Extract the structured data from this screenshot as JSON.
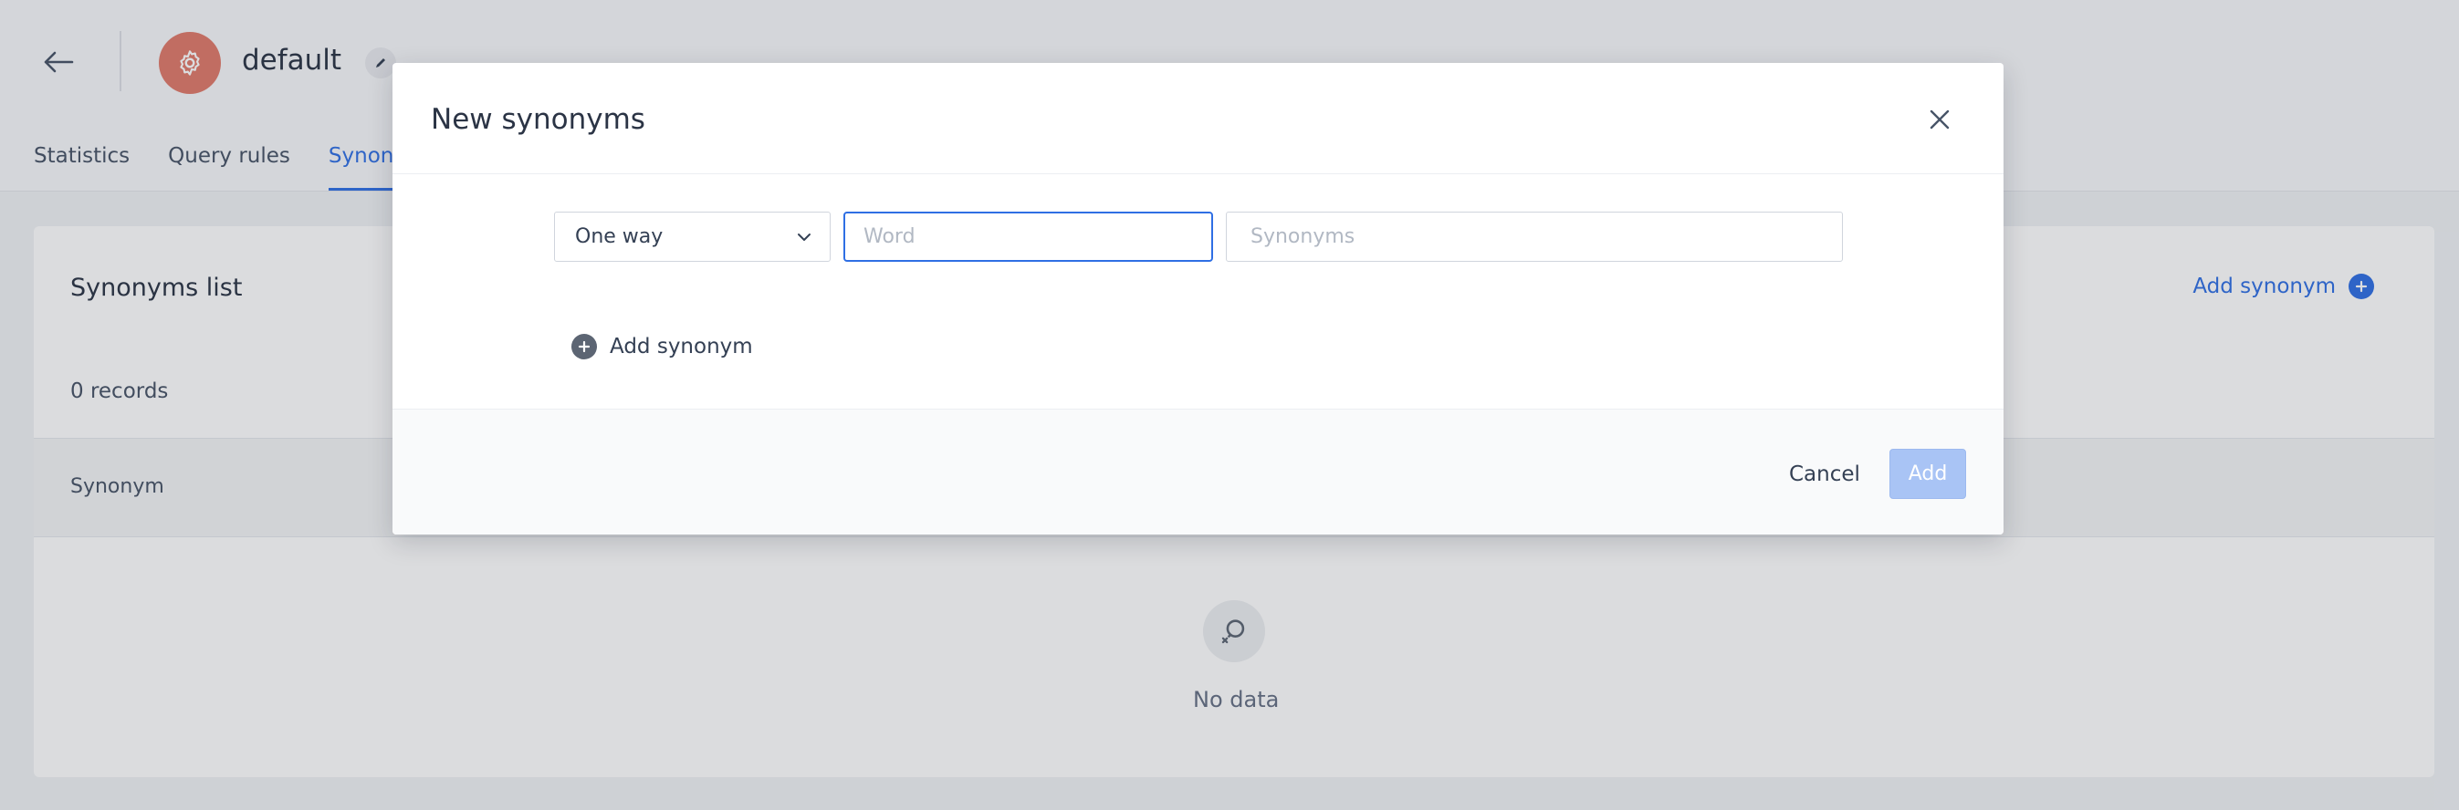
{
  "page": {
    "index_name": "default",
    "tabs": [
      "Statistics",
      "Query rules",
      "Synonyms"
    ],
    "active_tab": "Synonyms"
  },
  "card": {
    "title": "Synonyms list",
    "add_label": "Add synonym",
    "records": "0 records",
    "column_header": "Synonym",
    "empty_text": "No data"
  },
  "modal": {
    "title": "New synonyms",
    "type_select": {
      "value": "One way"
    },
    "word_input": {
      "value": "",
      "placeholder": "Word"
    },
    "synonyms_input": {
      "value": "",
      "placeholder": "Synonyms"
    },
    "add_row_label": "Add synonym",
    "cancel_label": "Cancel",
    "add_label": "Add"
  },
  "colors": {
    "accent": "#2f6fe4",
    "avatar": "#e07a6a",
    "add_button_disabled": "#a9c4f5"
  },
  "icons": [
    "back-arrow-icon",
    "gear-icon",
    "pencil-icon",
    "plus-circle-icon",
    "no-data-search-icon",
    "close-icon",
    "chevron-down-icon"
  ]
}
